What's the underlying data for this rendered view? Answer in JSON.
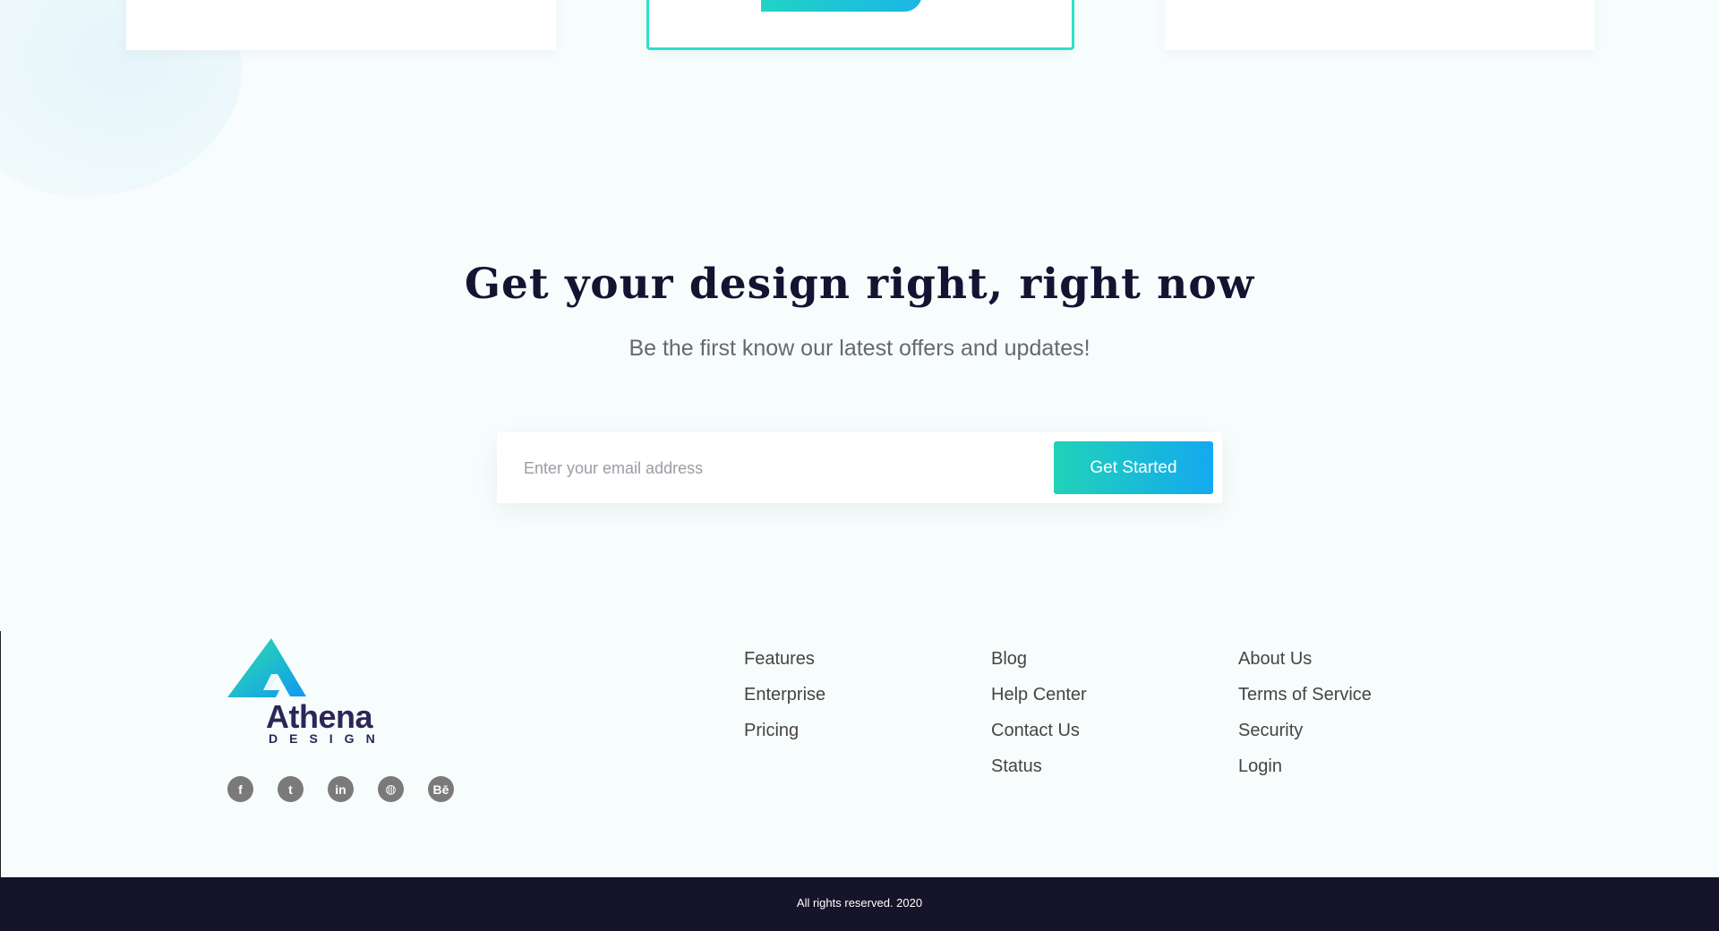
{
  "newsletter": {
    "headline": "Get your design right, right now",
    "subline": "Be the first know our latest offers and updates!",
    "email_placeholder": "Enter your email address",
    "email_value": "",
    "cta_label": "Get Started"
  },
  "brand": {
    "name": "Athena",
    "tagline": "DESIGN",
    "colors": {
      "gradient_start": "#21d2b8",
      "gradient_end": "#14a9f0",
      "dark": "#161429",
      "logo_text": "#2d2658"
    }
  },
  "social": [
    {
      "name": "facebook-icon",
      "glyph": "f"
    },
    {
      "name": "twitter-icon",
      "glyph": "t"
    },
    {
      "name": "linkedin-icon",
      "glyph": "in"
    },
    {
      "name": "dribbble-icon",
      "glyph": "◍"
    },
    {
      "name": "behance-icon",
      "glyph": "Bē"
    }
  ],
  "footer": {
    "col1": [
      "Features",
      "Enterprise",
      "Pricing"
    ],
    "col2": [
      "Blog",
      "Help Center",
      "Contact Us",
      "Status"
    ],
    "col3": [
      "About Us",
      "Terms of Service",
      "Security",
      "Login"
    ]
  },
  "copyright": "All rights reserved. 2020"
}
